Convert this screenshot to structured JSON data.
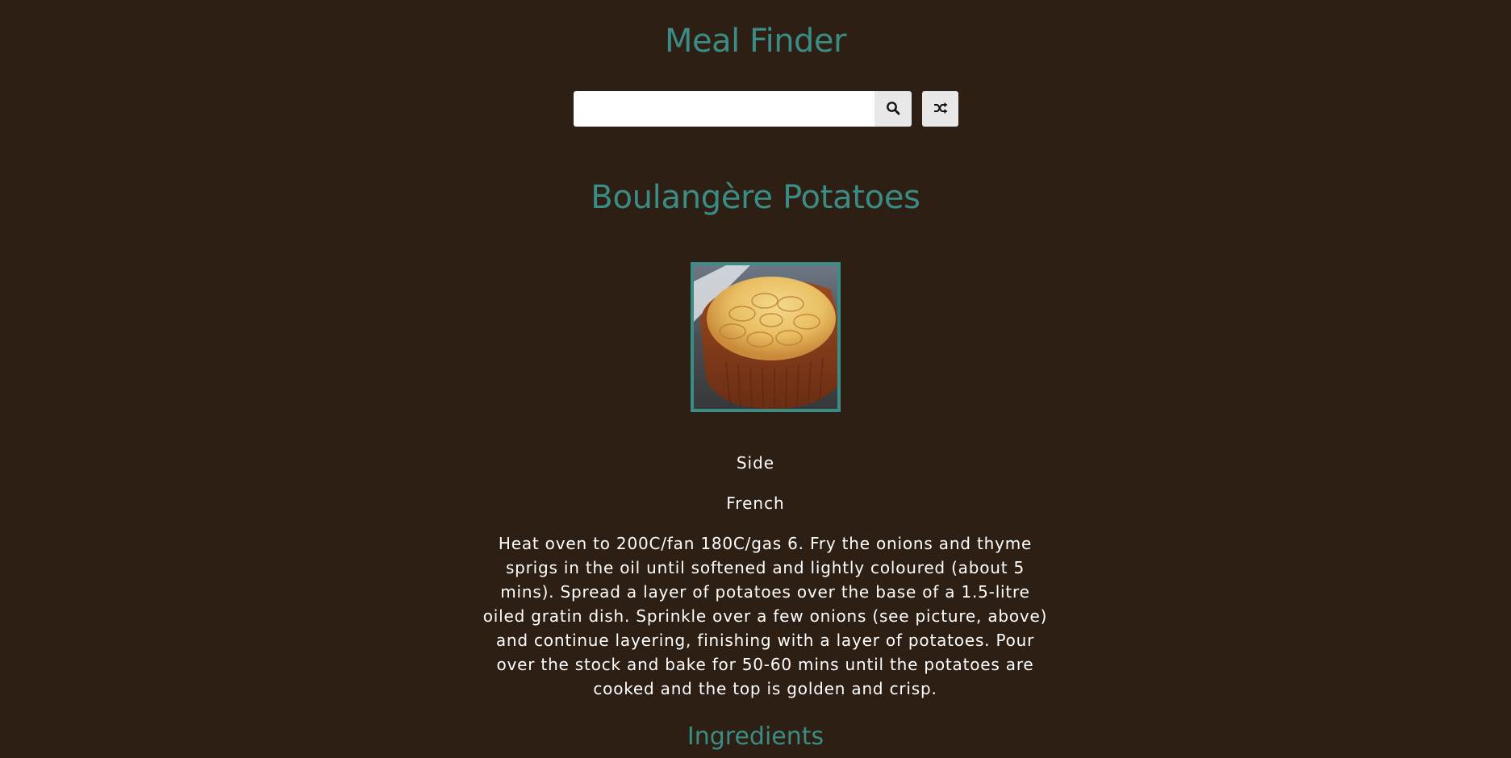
{
  "header": {
    "title": "Meal Finder"
  },
  "search": {
    "value": "",
    "placeholder": "",
    "search_icon": "search-icon",
    "random_icon": "shuffle-icon"
  },
  "meal": {
    "title": "Boulangère Potatoes",
    "category": "Side",
    "area": "French",
    "instructions": "Heat oven to 200C/fan 180C/gas 6. Fry the onions and thyme sprigs in the oil until softened and lightly coloured (about 5 mins). Spread a layer of potatoes over the base of a 1.5-litre oiled gratin dish. Sprinkle over a few onions (see picture, above) and continue layering, finishing with a layer of potatoes. Pour over the stock and bake for 50-60 mins until the potatoes are cooked and the top is golden and crisp.",
    "ingredients_heading": "Ingredients"
  },
  "colors": {
    "background": "#2d1f14",
    "accent": "#3a8c84",
    "text": "#ffffff",
    "button": "#e8e8e8"
  }
}
